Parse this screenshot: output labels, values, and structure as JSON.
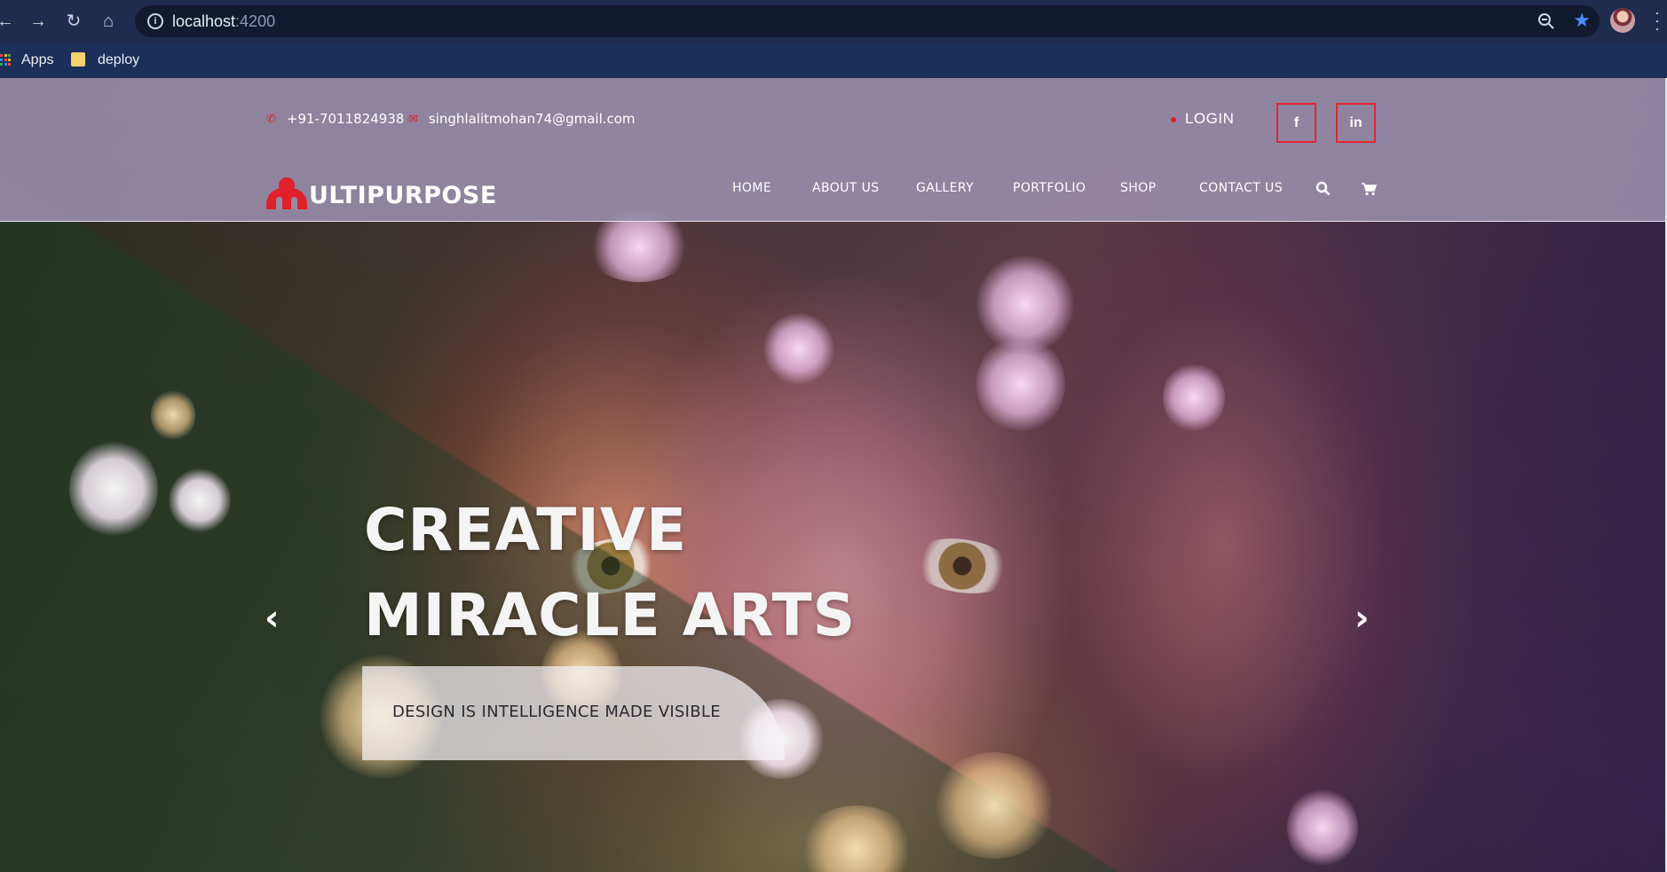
{
  "browser": {
    "url_host": "localhost",
    "url_port": ":4200",
    "bookmarks": [
      {
        "label": "Apps"
      },
      {
        "label": "deploy"
      }
    ]
  },
  "site": {
    "phone": "+91-7011824938",
    "email": "singhlalitmohan74@gmail.com",
    "login_label": "LOGIN",
    "social": {
      "facebook": "f",
      "linkedin": "in"
    },
    "logo_text": "ULTIPURPOSE",
    "nav": [
      {
        "label": "HOME"
      },
      {
        "label": "ABOUT US"
      },
      {
        "label": "GALLERY"
      },
      {
        "label": "PORTFOLIO"
      },
      {
        "label": "SHOP"
      },
      {
        "label": "CONTACT US"
      }
    ],
    "colors": {
      "accent": "#e1262c",
      "header_bg": "#978ba8"
    }
  },
  "hero": {
    "headline_line1": "CREATIVE",
    "headline_line2": "MIRACLE ARTS",
    "tagline": "DESIGN IS INTELLIGENCE MADE VISIBLE",
    "prev_icon": "chevron-left-icon",
    "next_icon": "chevron-right-icon"
  }
}
